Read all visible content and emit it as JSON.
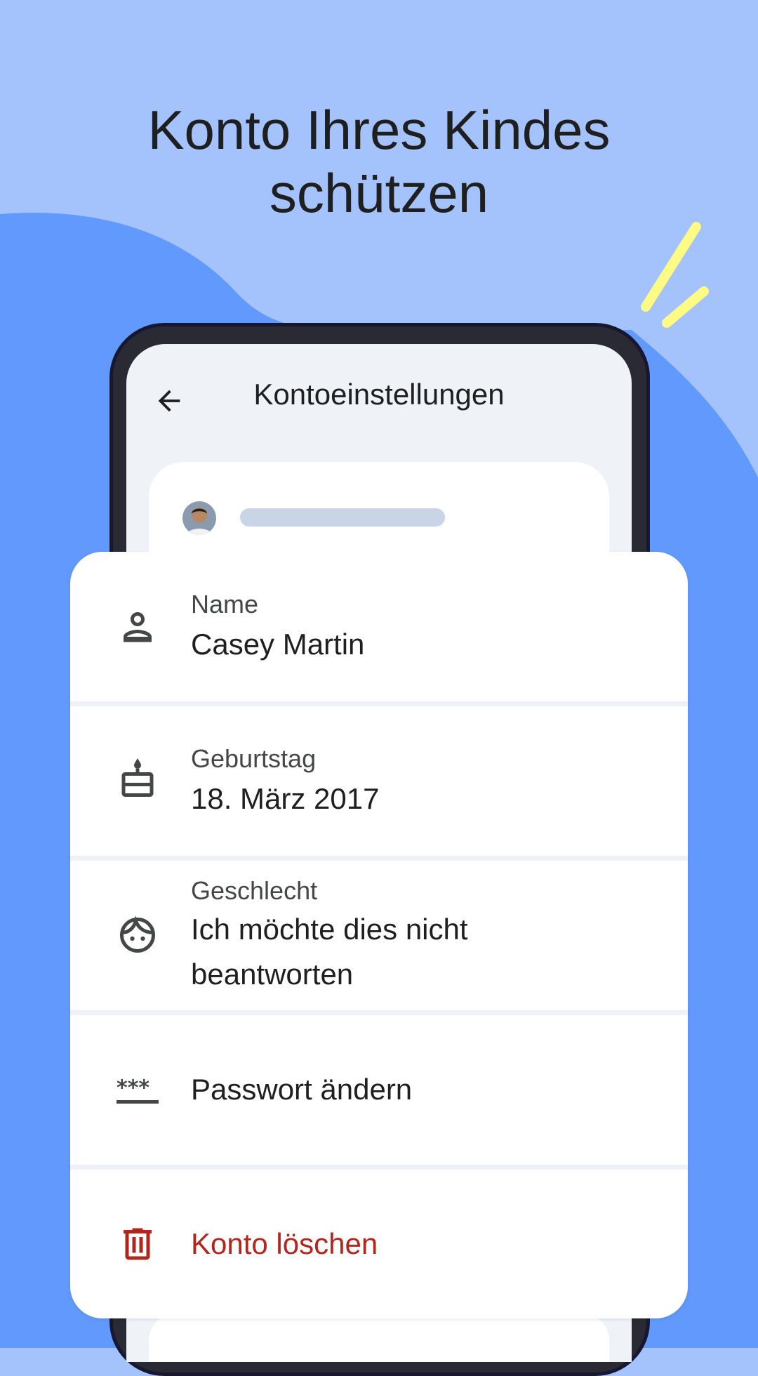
{
  "headline": {
    "line1": "Konto Ihres Kindes",
    "line2": "schützen"
  },
  "colors": {
    "background_light": "#a4c2fc",
    "background_blob": "#6299fc",
    "accent_yellow": "#fdfb84",
    "danger": "#b3261e"
  },
  "appbar": {
    "title": "Kontoeinstellungen",
    "back_icon": "arrow-left-icon"
  },
  "profile": {
    "avatar": "child-avatar"
  },
  "settings": {
    "name": {
      "icon": "person-icon",
      "label": "Name",
      "value": "Casey Martin"
    },
    "birthday": {
      "icon": "cake-icon",
      "label": "Geburtstag",
      "value": "18. März 2017"
    },
    "gender": {
      "icon": "face-icon",
      "label": "Geschlecht",
      "value": "Ich möchte dies nicht beantworten"
    },
    "password": {
      "icon": "password-icon",
      "label": "Passwort ändern"
    },
    "delete": {
      "icon": "trash-icon",
      "label": "Konto löschen"
    }
  }
}
